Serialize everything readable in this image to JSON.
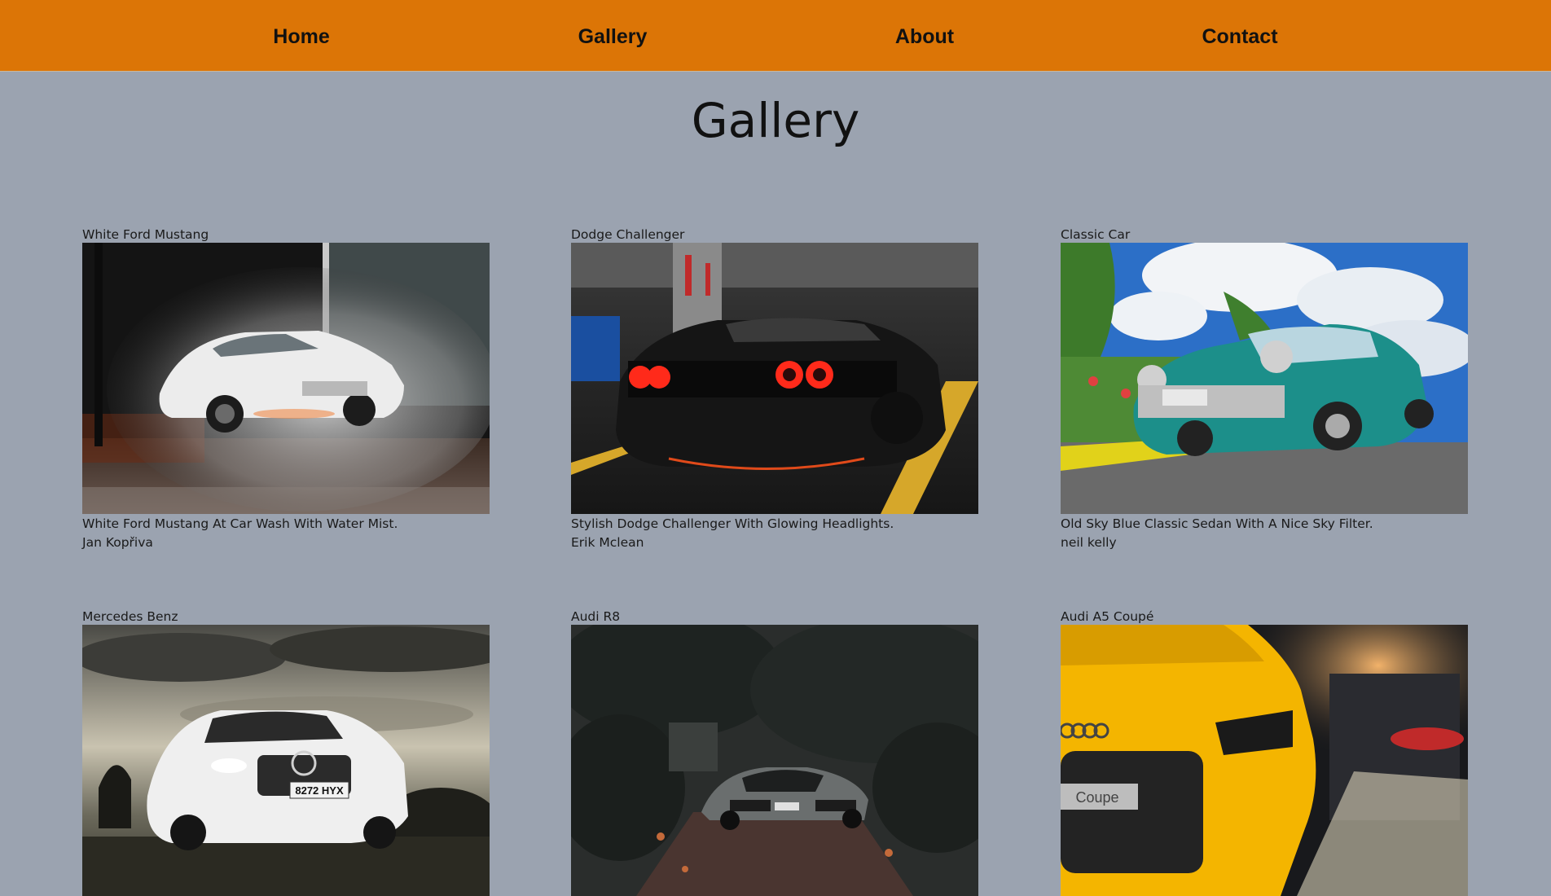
{
  "nav": {
    "items": [
      {
        "label": "Home"
      },
      {
        "label": "Gallery"
      },
      {
        "label": "About"
      },
      {
        "label": "Contact"
      }
    ]
  },
  "page": {
    "title": "Gallery"
  },
  "gallery": {
    "items": [
      {
        "title": "White Ford Mustang",
        "caption": "White Ford Mustang At Car Wash With Water Mist.",
        "author": "Jan Kopřiva"
      },
      {
        "title": "Dodge Challenger",
        "caption": "Stylish Dodge Challenger With Glowing Headlights.",
        "author": "Erik Mclean"
      },
      {
        "title": "Classic Car",
        "caption": "Old Sky Blue Classic Sedan With A Nice Sky Filter.",
        "author": "neil kelly"
      },
      {
        "title": "Mercedes Benz",
        "plate": "8272 HYX"
      },
      {
        "title": "Audi R8"
      },
      {
        "title": "Audi A5 Coupé",
        "badge": "Coupe"
      }
    ]
  },
  "colors": {
    "navbar": "#dc7506",
    "background": "#9ba3b0",
    "text": "#111111"
  }
}
